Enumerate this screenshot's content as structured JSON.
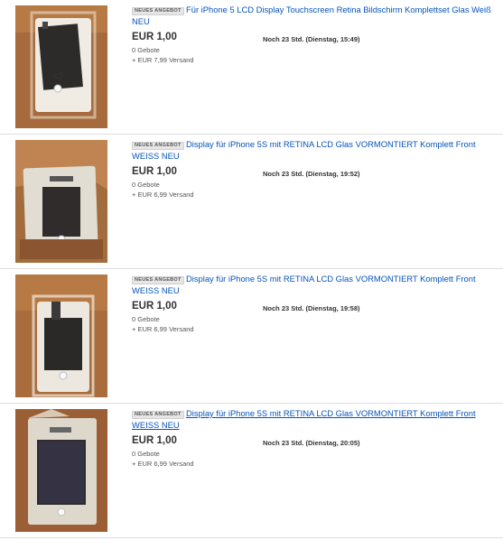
{
  "listings": [
    {
      "badge": "NEUES ANGEBOT",
      "title": "Für iPhone 5 LCD Display Touchscreen Retina Bildschirm Komplettset Glas Weiß NEU",
      "price": "EUR 1,00",
      "bids": "0 Gebote",
      "shipping": "+ EUR 7,99 Versand",
      "time_left": "Noch 23 Std. (Dienstag, 15:49)"
    },
    {
      "badge": "NEUES ANGEBOT",
      "title": "Display für iPhone 5S mit RETINA LCD Glas VORMONTIERT Komplett Front WEISS NEU",
      "price": "EUR 1,00",
      "bids": "0 Gebote",
      "shipping": "+ EUR 6,99 Versand",
      "time_left": "Noch 23 Std. (Dienstag, 19:52)"
    },
    {
      "badge": "NEUES ANGEBOT",
      "title": "Display für iPhone 5S mit RETINA LCD Glas VORMONTIERT Komplett Front WEISS NEU",
      "price": "EUR 1,00",
      "bids": "0 Gebote",
      "shipping": "+ EUR 6,99 Versand",
      "time_left": "Noch 23 Std. (Dienstag, 19:58)"
    },
    {
      "badge": "NEUES ANGEBOT",
      "title": "Display für iPhone 5S mit RETINA LCD Glas VORMONTIERT Komplett Front WEISS NEU",
      "price": "EUR 1,00",
      "bids": "0 Gebote",
      "shipping": "+ EUR 6,99 Versand",
      "time_left": "Noch 23 Std. (Dienstag, 20:05)"
    }
  ],
  "colors": {
    "link": "#0654ba",
    "badge_bg": "#e6e6e6",
    "photo_background": "#b87a45"
  }
}
